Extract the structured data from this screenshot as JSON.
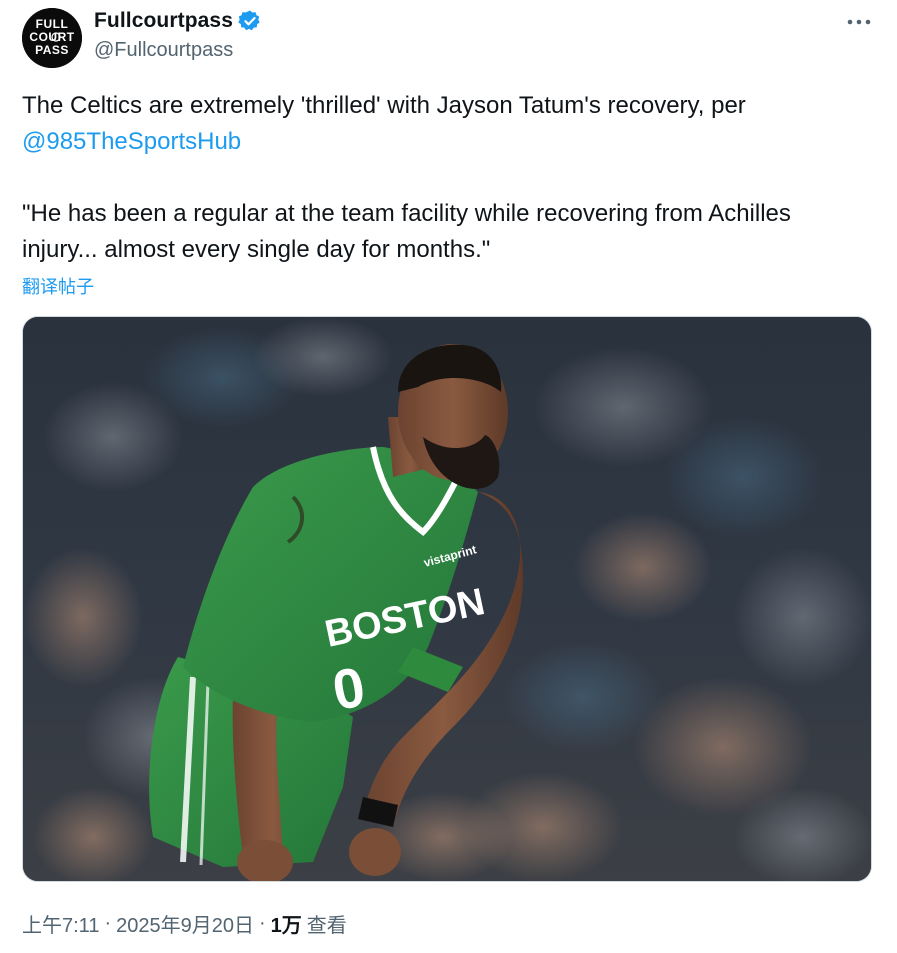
{
  "author": {
    "display_name": "Fullcourtpass",
    "handle": "@Fullcourtpass",
    "avatar_text": "FULL COURT PASS",
    "verified_color": "#1d9bf0"
  },
  "tweet": {
    "line1": "The Celtics are extremely 'thrilled' with Jayson Tatum's recovery, per ",
    "mention": "@985TheSportsHub",
    "quote": "\"He has been a regular at the team facility while recovering from Achilles injury... almost every single day for months.\""
  },
  "translate_label": "翻译帖子",
  "media": {
    "jersey_text": "BOSTON",
    "jersey_number": "0",
    "sponsor_text": "vistaprint",
    "icon": "photo"
  },
  "meta": {
    "time": "上午7:11",
    "date": "2025年9月20日",
    "separator": "·",
    "views_count": "1万",
    "views_label": "查看"
  },
  "colors": {
    "link": "#1d9bf0",
    "secondary_text": "#536471",
    "celtics_green": "#2e8b3d"
  }
}
